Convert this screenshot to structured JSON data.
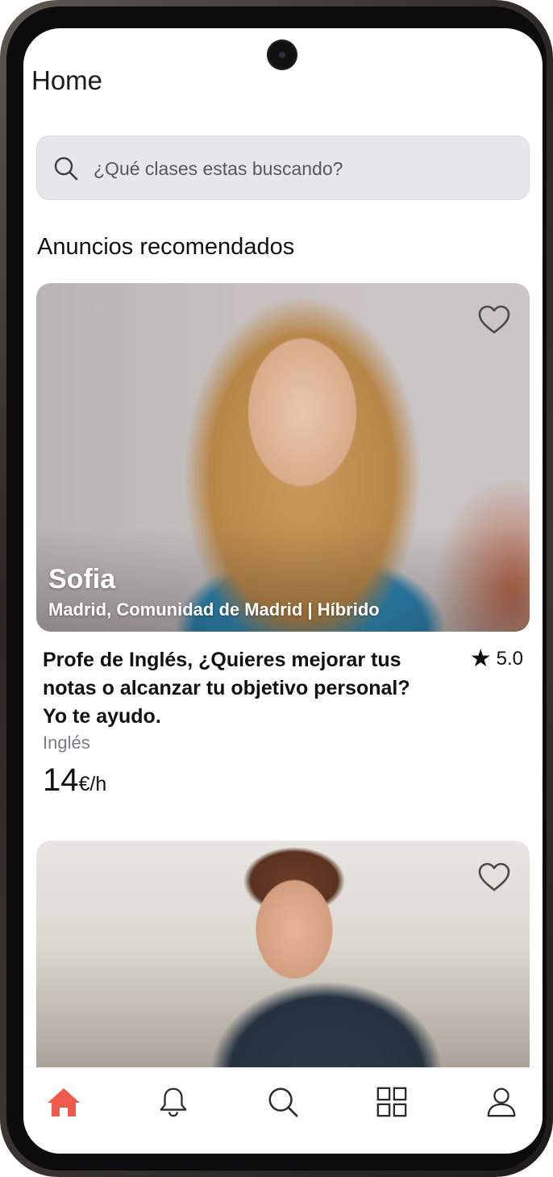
{
  "header": {
    "title": "Home"
  },
  "search": {
    "placeholder": "¿Qué clases estas buscando?",
    "icon": "search-icon"
  },
  "section": {
    "title": "Anuncios recomendados"
  },
  "listings": [
    {
      "name": "Sofia",
      "location": "Madrid, Comunidad de Madrid | Híbrido",
      "title": "Profe de Inglés, ¿Quieres mejorar tus notas o alcanzar tu objetivo personal? Yo te ayudo.",
      "rating": "5.0",
      "subject": "Inglés",
      "price": "14",
      "price_unit": "€/h",
      "favorite_icon": "heart-outline-icon"
    },
    {
      "favorite_icon": "heart-outline-icon"
    }
  ],
  "nav": {
    "items": [
      {
        "icon": "home-icon",
        "active": true
      },
      {
        "icon": "bell-icon",
        "active": false
      },
      {
        "icon": "search-icon",
        "active": false
      },
      {
        "icon": "grid-icon",
        "active": false
      },
      {
        "icon": "user-icon",
        "active": false
      }
    ],
    "active_color": "#ef5a4c",
    "inactive_color": "#2b2b2b"
  }
}
